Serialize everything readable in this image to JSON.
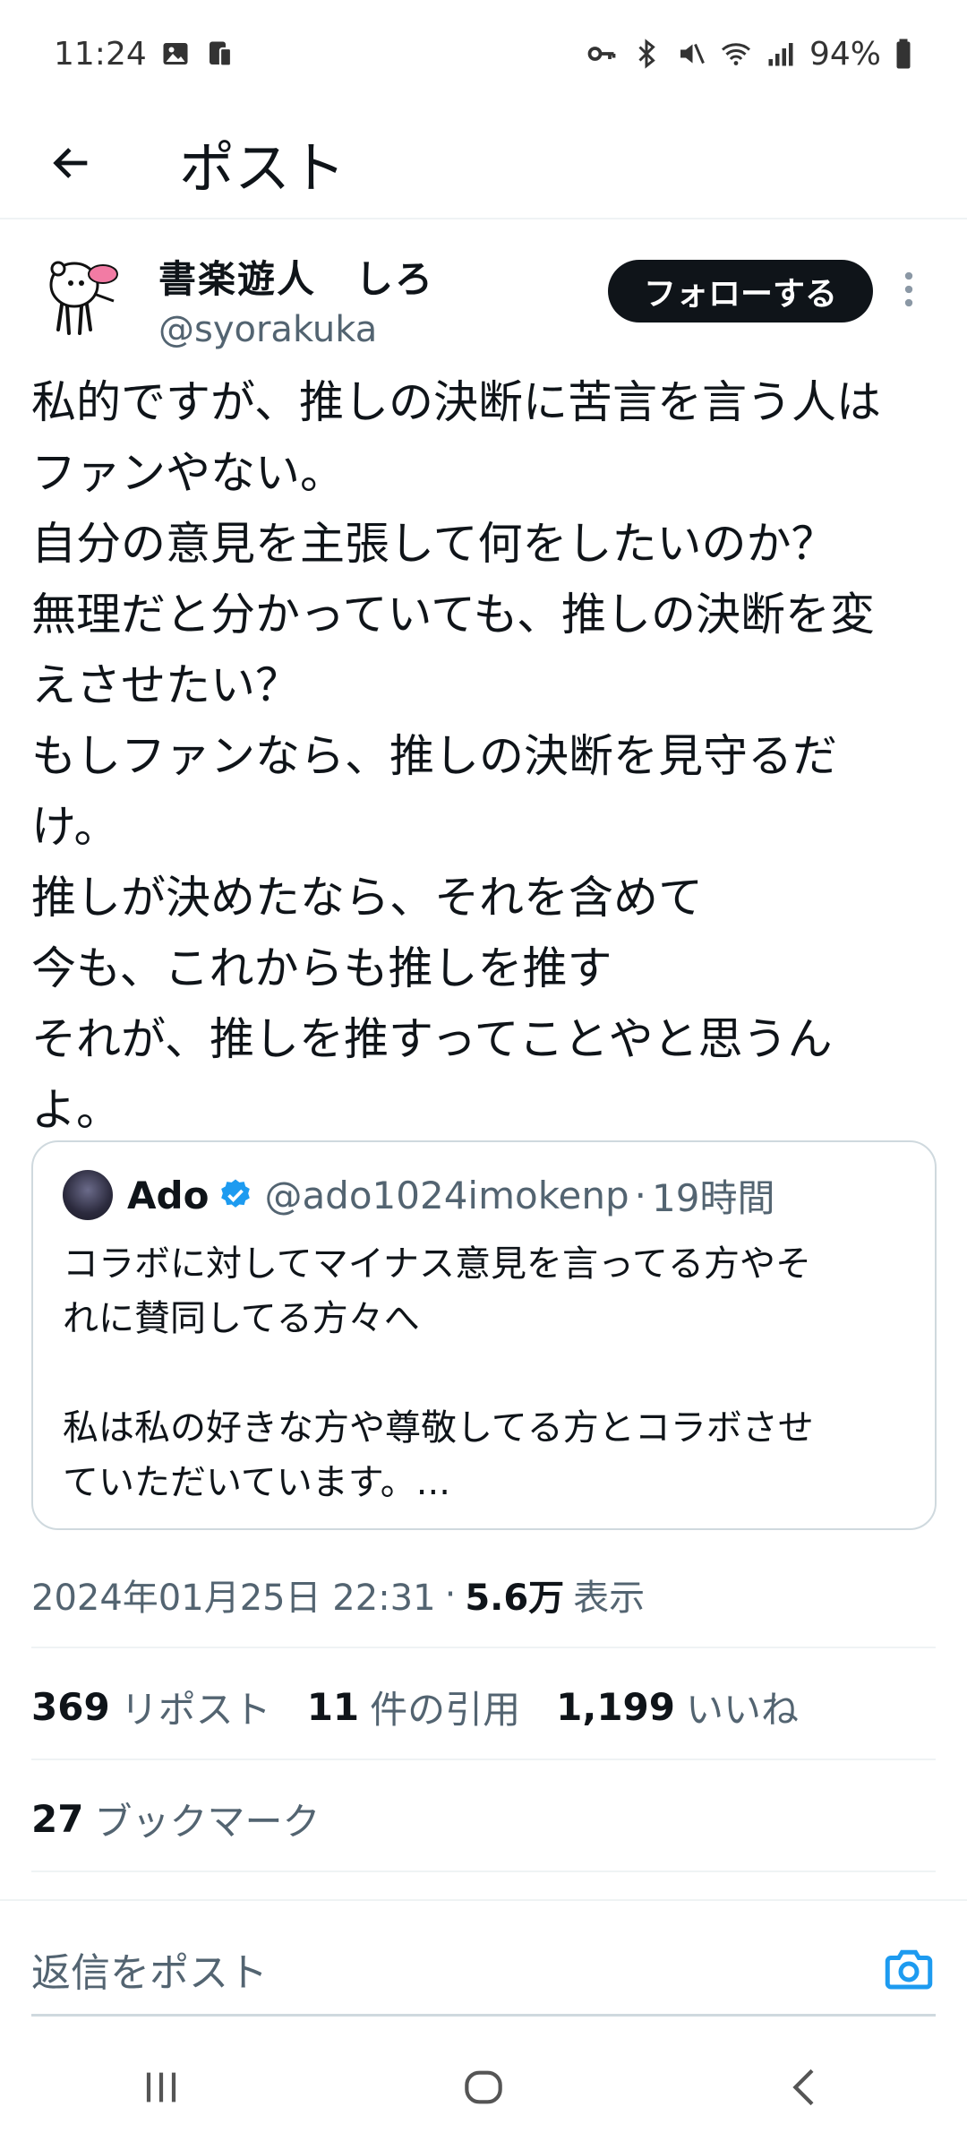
{
  "status_bar": {
    "time": "11:24",
    "battery": "94%",
    "icons": [
      "gallery-icon",
      "phone-sync-icon",
      "key-icon",
      "bluetooth-icon",
      "mute-icon",
      "wifi-icon",
      "signal-icon",
      "battery-icon"
    ]
  },
  "header": {
    "title": "ポスト",
    "back_icon": "arrow-left-icon"
  },
  "author": {
    "display_name": "書楽遊人　しろ",
    "handle": "@syorakuka",
    "follow_label": "フォローする"
  },
  "tweet": {
    "text": "私的ですが、推しの決断に苦言を言う人は\nファンやない。\n自分の意見を主張して何をしたいのか？\n無理だと分かっていても、推しの決断を変\nえさせたい？\nもしファンなら、推しの決断を見守るだ\nけ。\n推しが決めたなら、それを含めて\n今も、これからも推しを推す\nそれが、推しを推すってことやと思うん\nよ。"
  },
  "quote": {
    "name": "Ado",
    "handle": "@ado1024imokenp",
    "separator": "·",
    "time": "19時間",
    "text": "コラボに対してマイナス意見を言ってる方やそ\nれに賛同してる方々へ\n\n私は私の好きな方や尊敬してる方とコラボさせ\nていただいています。..."
  },
  "meta": {
    "datetime": "2024年01月25日 22:31",
    "separator": "·",
    "views_count": "5.6万",
    "views_label": "表示"
  },
  "stats": {
    "reposts_count": "369",
    "reposts_label": "リポスト",
    "quotes_count": "11",
    "quotes_label": "件の引用",
    "likes_count": "1,199",
    "likes_label": "いいね",
    "bookmarks_count": "27",
    "bookmarks_label": "ブックマーク"
  },
  "reply": {
    "placeholder": "返信をポスト"
  },
  "colors": {
    "text": "#0f1419",
    "secondary": "#536471",
    "accent": "#1d9bf0",
    "border": "#cfd9de"
  }
}
